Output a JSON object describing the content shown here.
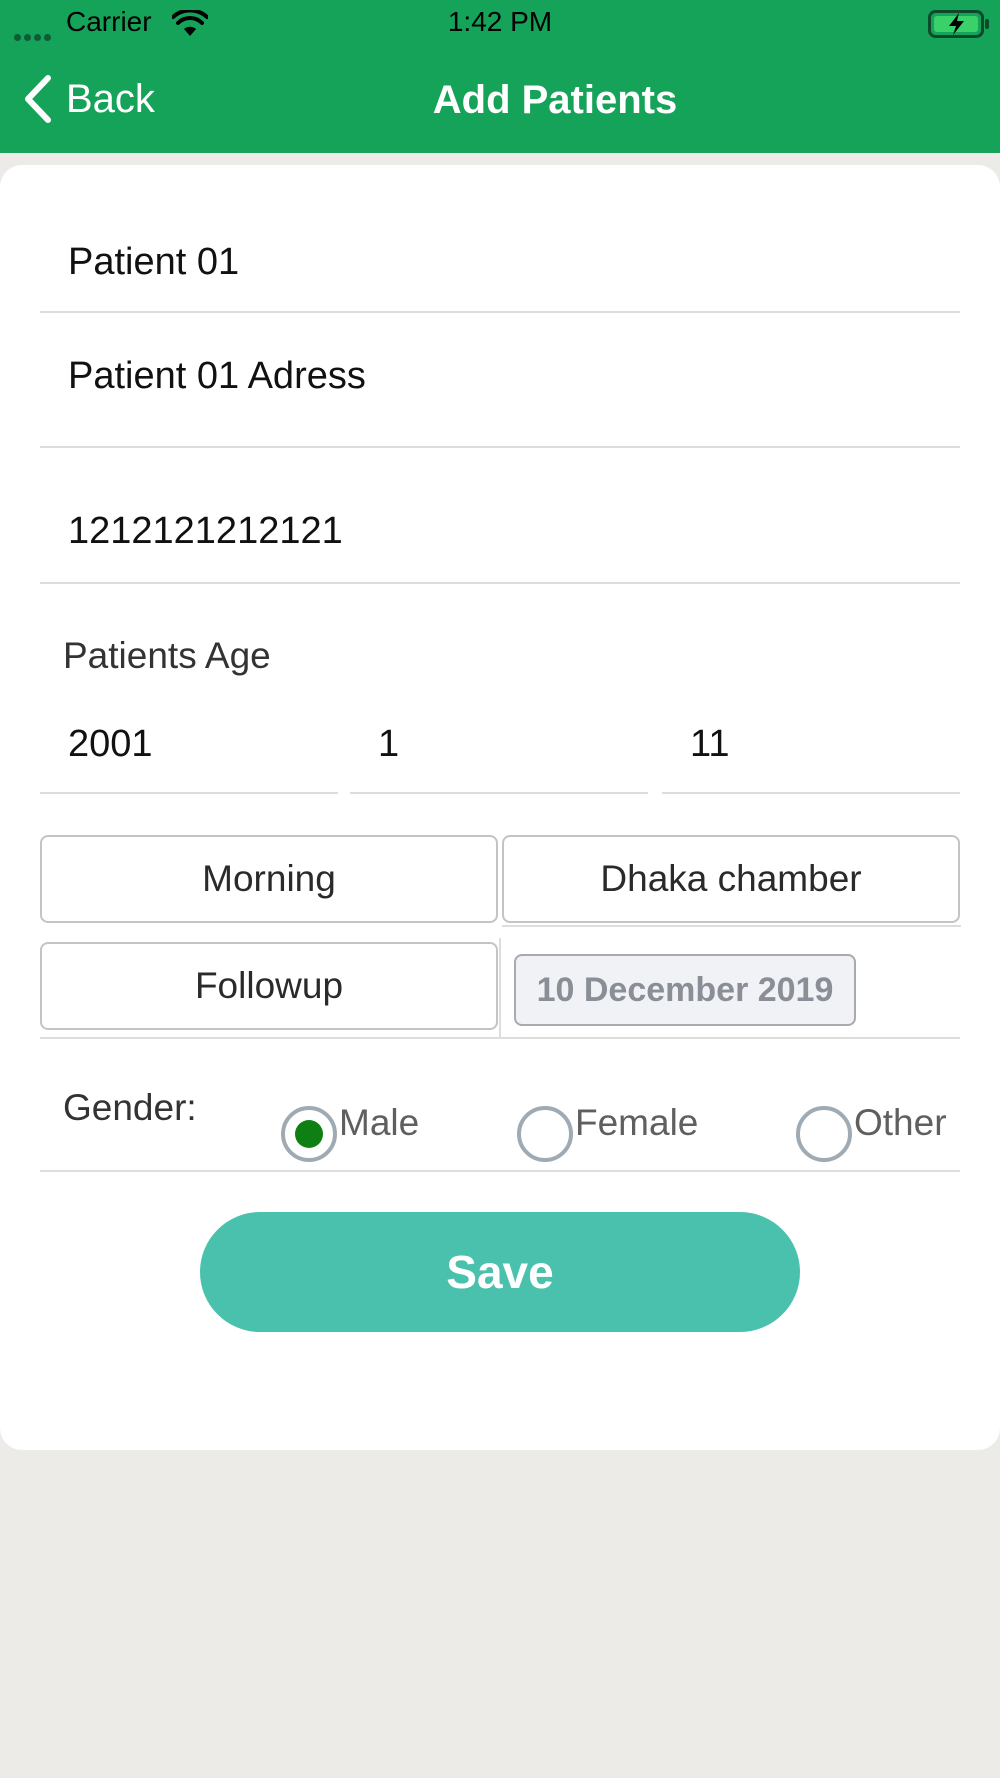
{
  "status_bar": {
    "carrier": "Carrier",
    "time": "1:42 PM"
  },
  "nav": {
    "back_label": "Back",
    "title": "Add Patients"
  },
  "form": {
    "patient_name": "Patient 01",
    "patient_address": "Patient 01 Adress",
    "patient_phone": "1212121212121",
    "age_label": "Patients Age",
    "age_year": "2001",
    "age_month": "1",
    "age_day": "11",
    "shift_button": "Morning",
    "chamber_button": "Dhaka chamber",
    "visit_type_button": "Followup",
    "date_button": "10 December 2019",
    "gender_label": "Gender:",
    "gender_options": [
      "Male",
      "Female",
      "Other"
    ],
    "gender_selected": "Male",
    "save_label": "Save"
  },
  "colors": {
    "header_bg": "#15a259",
    "save_bg": "#4ac1ac",
    "radio_selected": "#0e7f12",
    "page_bg": "#edebe8"
  }
}
